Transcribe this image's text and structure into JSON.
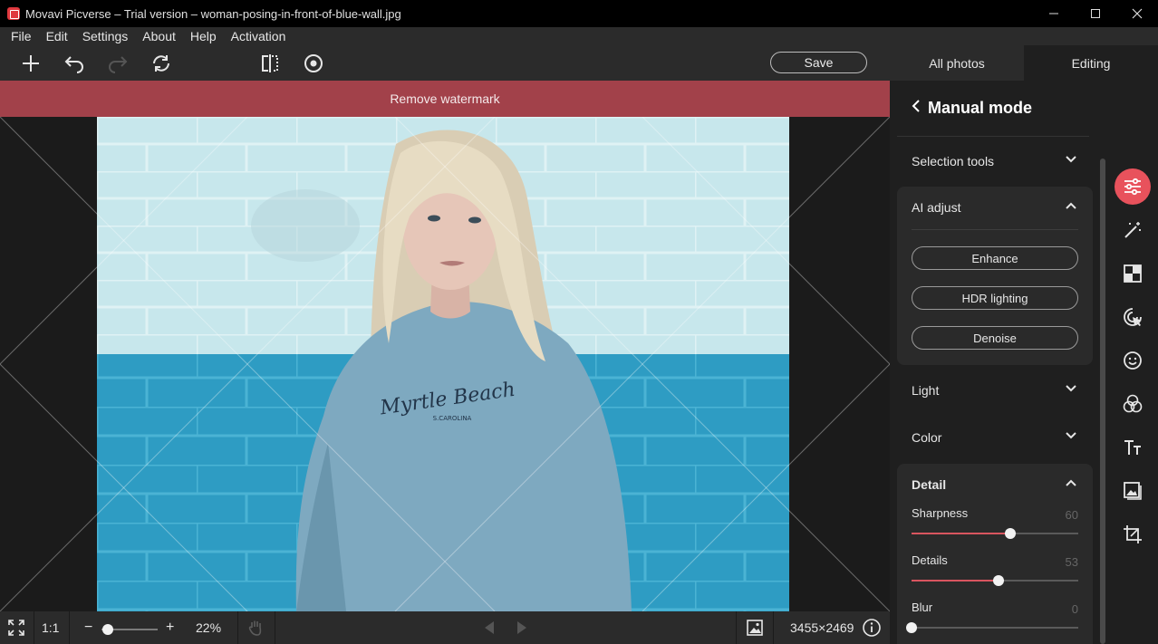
{
  "window": {
    "title": "Movavi Picverse – Trial version – woman-posing-in-front-of-blue-wall.jpg",
    "minimize": "—",
    "maximize": "☐",
    "close": "✕"
  },
  "menu": [
    "File",
    "Edit",
    "Settings",
    "About",
    "Help",
    "Activation"
  ],
  "toolbar": {
    "save_label": "Save",
    "tab_all_photos": "All photos",
    "tab_editing": "Editing"
  },
  "watermark_banner": "Remove watermark",
  "photo_print": {
    "line1": "Myrtle Beach",
    "line2": "S.CAROLINA"
  },
  "bottom": {
    "ratio": "1:1",
    "zoom_minus": "−",
    "zoom_plus": "+",
    "zoom": "22%",
    "zoom_level": 0.22,
    "dimensions": "3455×2469"
  },
  "panel": {
    "back": "‹",
    "title": "Manual mode",
    "sections": {
      "selection_tools": "Selection tools",
      "ai_adjust": "AI adjust",
      "light": "Light",
      "color": "Color",
      "detail": "Detail"
    },
    "ai_buttons": [
      "Enhance",
      "HDR lighting",
      "Denoise"
    ],
    "sliders": [
      {
        "label": "Sharpness",
        "value": "60",
        "fraction": 0.59
      },
      {
        "label": "Details",
        "value": "53",
        "fraction": 0.52
      },
      {
        "label": "Blur",
        "value": "0",
        "fraction": 0.0
      }
    ]
  },
  "colors": {
    "accent": "#e8525c",
    "banner": "#a2414a",
    "panel_bg": "#1f1f1f",
    "toolbar_bg": "#2b2b2b"
  },
  "strip_tools": [
    "adjust-sliders-icon",
    "magic-wand-icon",
    "checkerboard-icon",
    "cursor-target-icon",
    "face-icon",
    "color-circles-icon",
    "text-icon",
    "image-icon",
    "crop-icon"
  ]
}
